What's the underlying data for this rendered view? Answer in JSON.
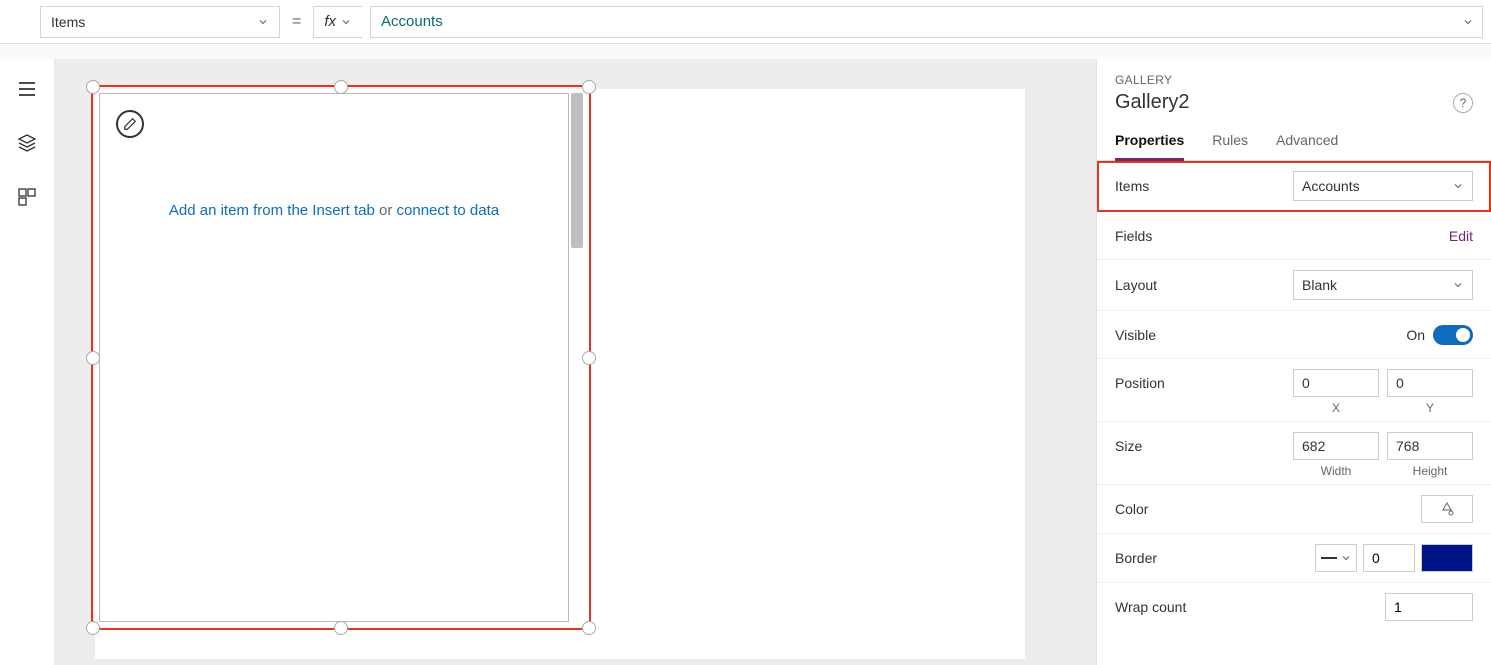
{
  "formula_bar": {
    "property": "Items",
    "fx_label": "fx",
    "value": "Accounts"
  },
  "canvas": {
    "hint_link1": "Add an item from the Insert tab",
    "hint_or": " or ",
    "hint_link2": "connect to data"
  },
  "panel": {
    "type": "GALLERY",
    "name": "Gallery2",
    "tabs": {
      "properties": "Properties",
      "rules": "Rules",
      "advanced": "Advanced"
    },
    "items": {
      "label": "Items",
      "value": "Accounts"
    },
    "fields": {
      "label": "Fields",
      "action": "Edit"
    },
    "layout": {
      "label": "Layout",
      "value": "Blank"
    },
    "visible": {
      "label": "Visible",
      "state": "On"
    },
    "position": {
      "label": "Position",
      "x": "0",
      "y": "0",
      "xlabel": "X",
      "ylabel": "Y"
    },
    "size": {
      "label": "Size",
      "w": "682",
      "h": "768",
      "wlabel": "Width",
      "hlabel": "Height"
    },
    "color": {
      "label": "Color"
    },
    "border": {
      "label": "Border",
      "width": "0",
      "color": "#001487"
    },
    "wrap": {
      "label": "Wrap count",
      "value": "1"
    }
  }
}
